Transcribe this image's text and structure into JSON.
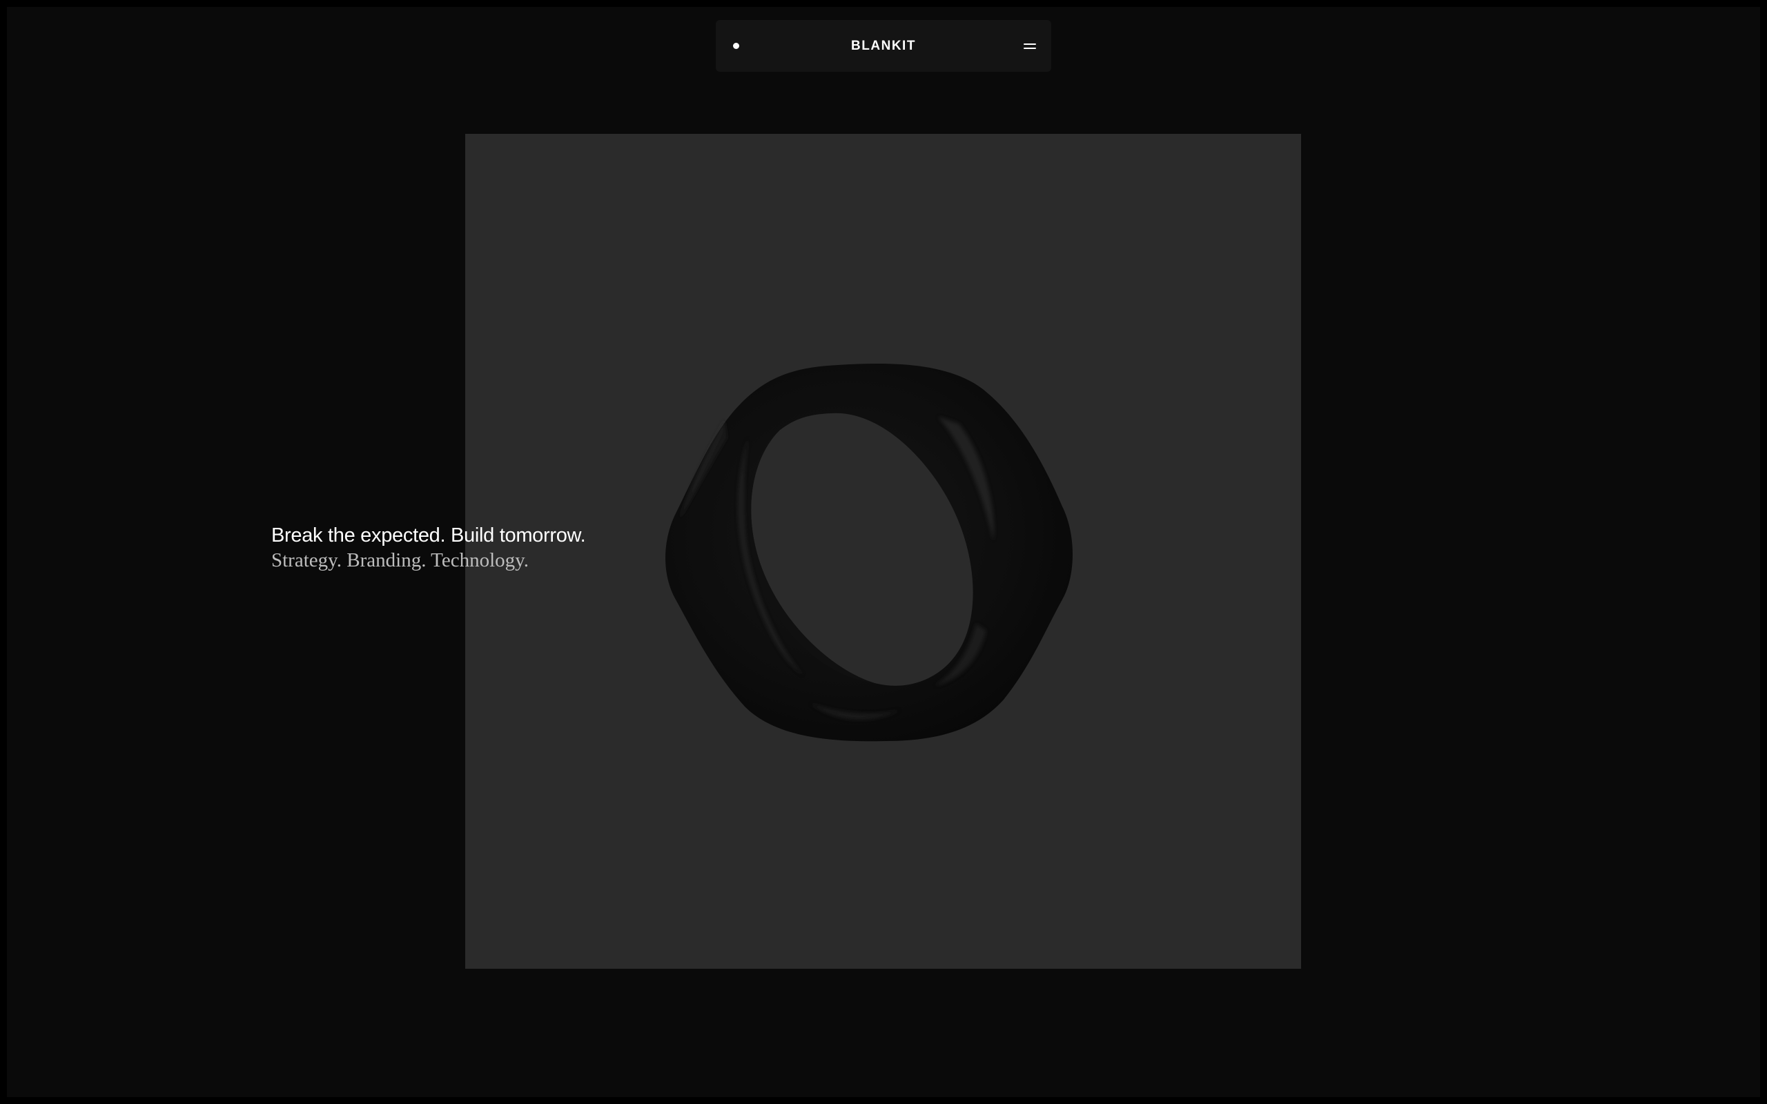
{
  "header": {
    "brand": "BLANKIT",
    "dot_icon": "dot-icon",
    "menu_icon": "menu-icon"
  },
  "hero": {
    "headline": "Break the expected. Build tomorrow.",
    "subline": "Strategy. Branding. Technology.",
    "image_subject": "ring"
  },
  "colors": {
    "page_background": "#0a0a0a",
    "outer_frame": "#000000",
    "nav_background": "#141414",
    "panel_background": "#2b2b2b",
    "text_primary": "#ffffff",
    "text_secondary": "#bdbdbd",
    "ring": "#0d0d0d"
  }
}
